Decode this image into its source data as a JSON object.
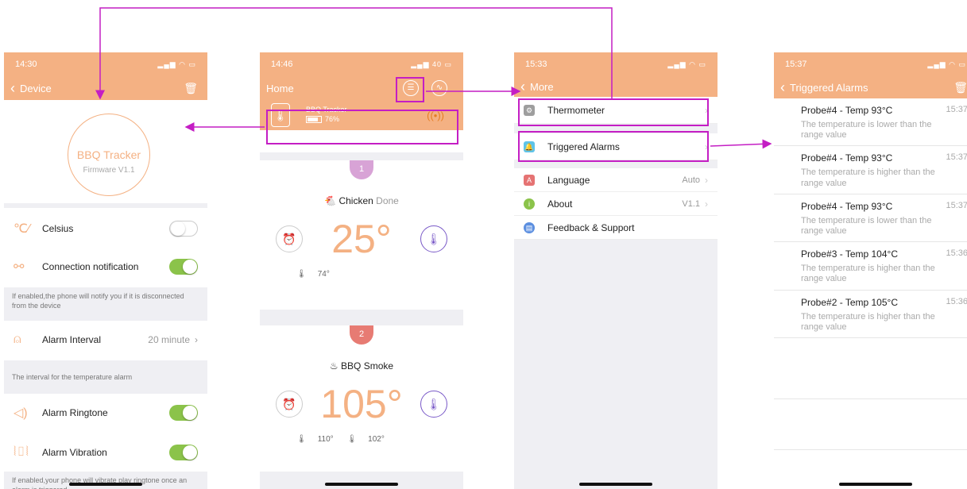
{
  "colors": {
    "accent": "#f4b183",
    "annotation": "#c41ec4",
    "toggle_on": "#8bc34a",
    "probe1": "#d8a3d6",
    "probe2": "#e77b73"
  },
  "device_screen": {
    "time": "14:30",
    "title": "Device",
    "device_name": "BBQ Tracker",
    "firmware": "Firmware V1.1",
    "rows": {
      "celsius": {
        "label": "Celsius",
        "on": false
      },
      "connection": {
        "label": "Connection notification",
        "on": true
      },
      "connection_note": "If enabled,the phone will notify you if it is disconnected from the device",
      "alarm_interval": {
        "label": "Alarm Interval",
        "value": "20 minute"
      },
      "interval_note": "The interval for the temperature alarm",
      "ringtone": {
        "label": "Alarm Ringtone",
        "on": true
      },
      "vibration": {
        "label": "Alarm Vibration",
        "on": true
      },
      "vibration_note": "If enabled,your phone will vibrate play ringtone once an alarm is triggered"
    }
  },
  "home_screen": {
    "time": "14:46",
    "title": "Home",
    "tracker_name": "BBQ Tracker",
    "battery": "76%",
    "probes": [
      {
        "number": "1",
        "food": "Chicken",
        "status": "Done",
        "temp": "25°",
        "sub_temps": [
          "74°"
        ]
      },
      {
        "number": "2",
        "food": "BBQ Smoke",
        "status": "",
        "temp": "105°",
        "sub_temps": [
          "110°",
          "102°"
        ]
      }
    ]
  },
  "more_screen": {
    "time": "15:33",
    "title": "More",
    "items": [
      {
        "label": "Thermometer",
        "value": "",
        "icon": "gear-icon"
      },
      {
        "label": "Triggered Alarms",
        "value": "",
        "icon": "bell-icon"
      },
      {
        "label": "Language",
        "value": "Auto",
        "icon": "language-icon"
      },
      {
        "label": "About",
        "value": "V1.1",
        "icon": "info-icon"
      },
      {
        "label": "Feedback & Support",
        "value": "",
        "icon": "chat-icon"
      }
    ]
  },
  "alarms_screen": {
    "time": "15:37",
    "title": "Triggered Alarms",
    "alarms": [
      {
        "title": "Probe#4  - Temp 93°C",
        "time": "15:37",
        "message": "The temperature is lower than the range value"
      },
      {
        "title": "Probe#4  - Temp 93°C",
        "time": "15:37",
        "message": "The temperature is higher than the range value"
      },
      {
        "title": "Probe#4  - Temp 93°C",
        "time": "15:37",
        "message": "The temperature is lower than the range value"
      },
      {
        "title": "Probe#3  - Temp 104°C",
        "time": "15:36",
        "message": "The temperature is higher than the range value"
      },
      {
        "title": "Probe#2  - Temp 105°C",
        "time": "15:36",
        "message": "The temperature is higher than the range value"
      }
    ]
  }
}
